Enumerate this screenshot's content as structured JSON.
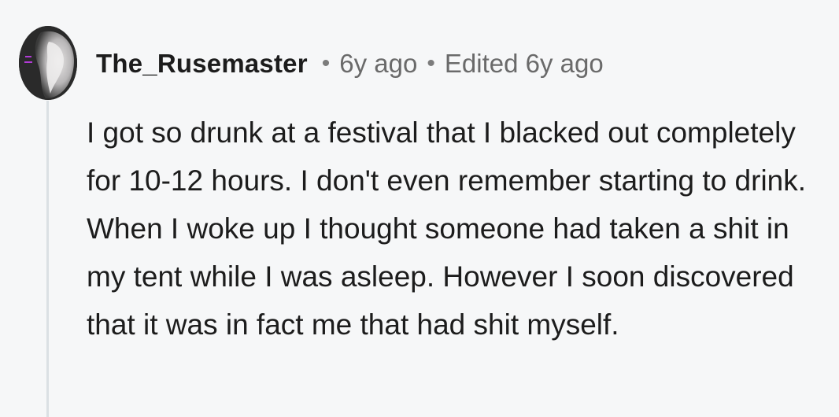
{
  "comment": {
    "author": "The_Rusemaster",
    "separator": "•",
    "posted": "6y ago",
    "edited": "Edited 6y ago",
    "body": "I got so drunk at a festival that I blacked out completely for 10-12 hours. I don't even remember starting to drink. When I woke up I thought someone had taken a shit in my tent while I was asleep. However I soon discovered that it was in fact me that had shit myself.",
    "avatar_icon": "user-avatar"
  },
  "colors": {
    "background": "#f6f7f8",
    "thread_line": "#dbe0e4",
    "text": "#1c1c1c",
    "meta": "#6a6a6a"
  }
}
